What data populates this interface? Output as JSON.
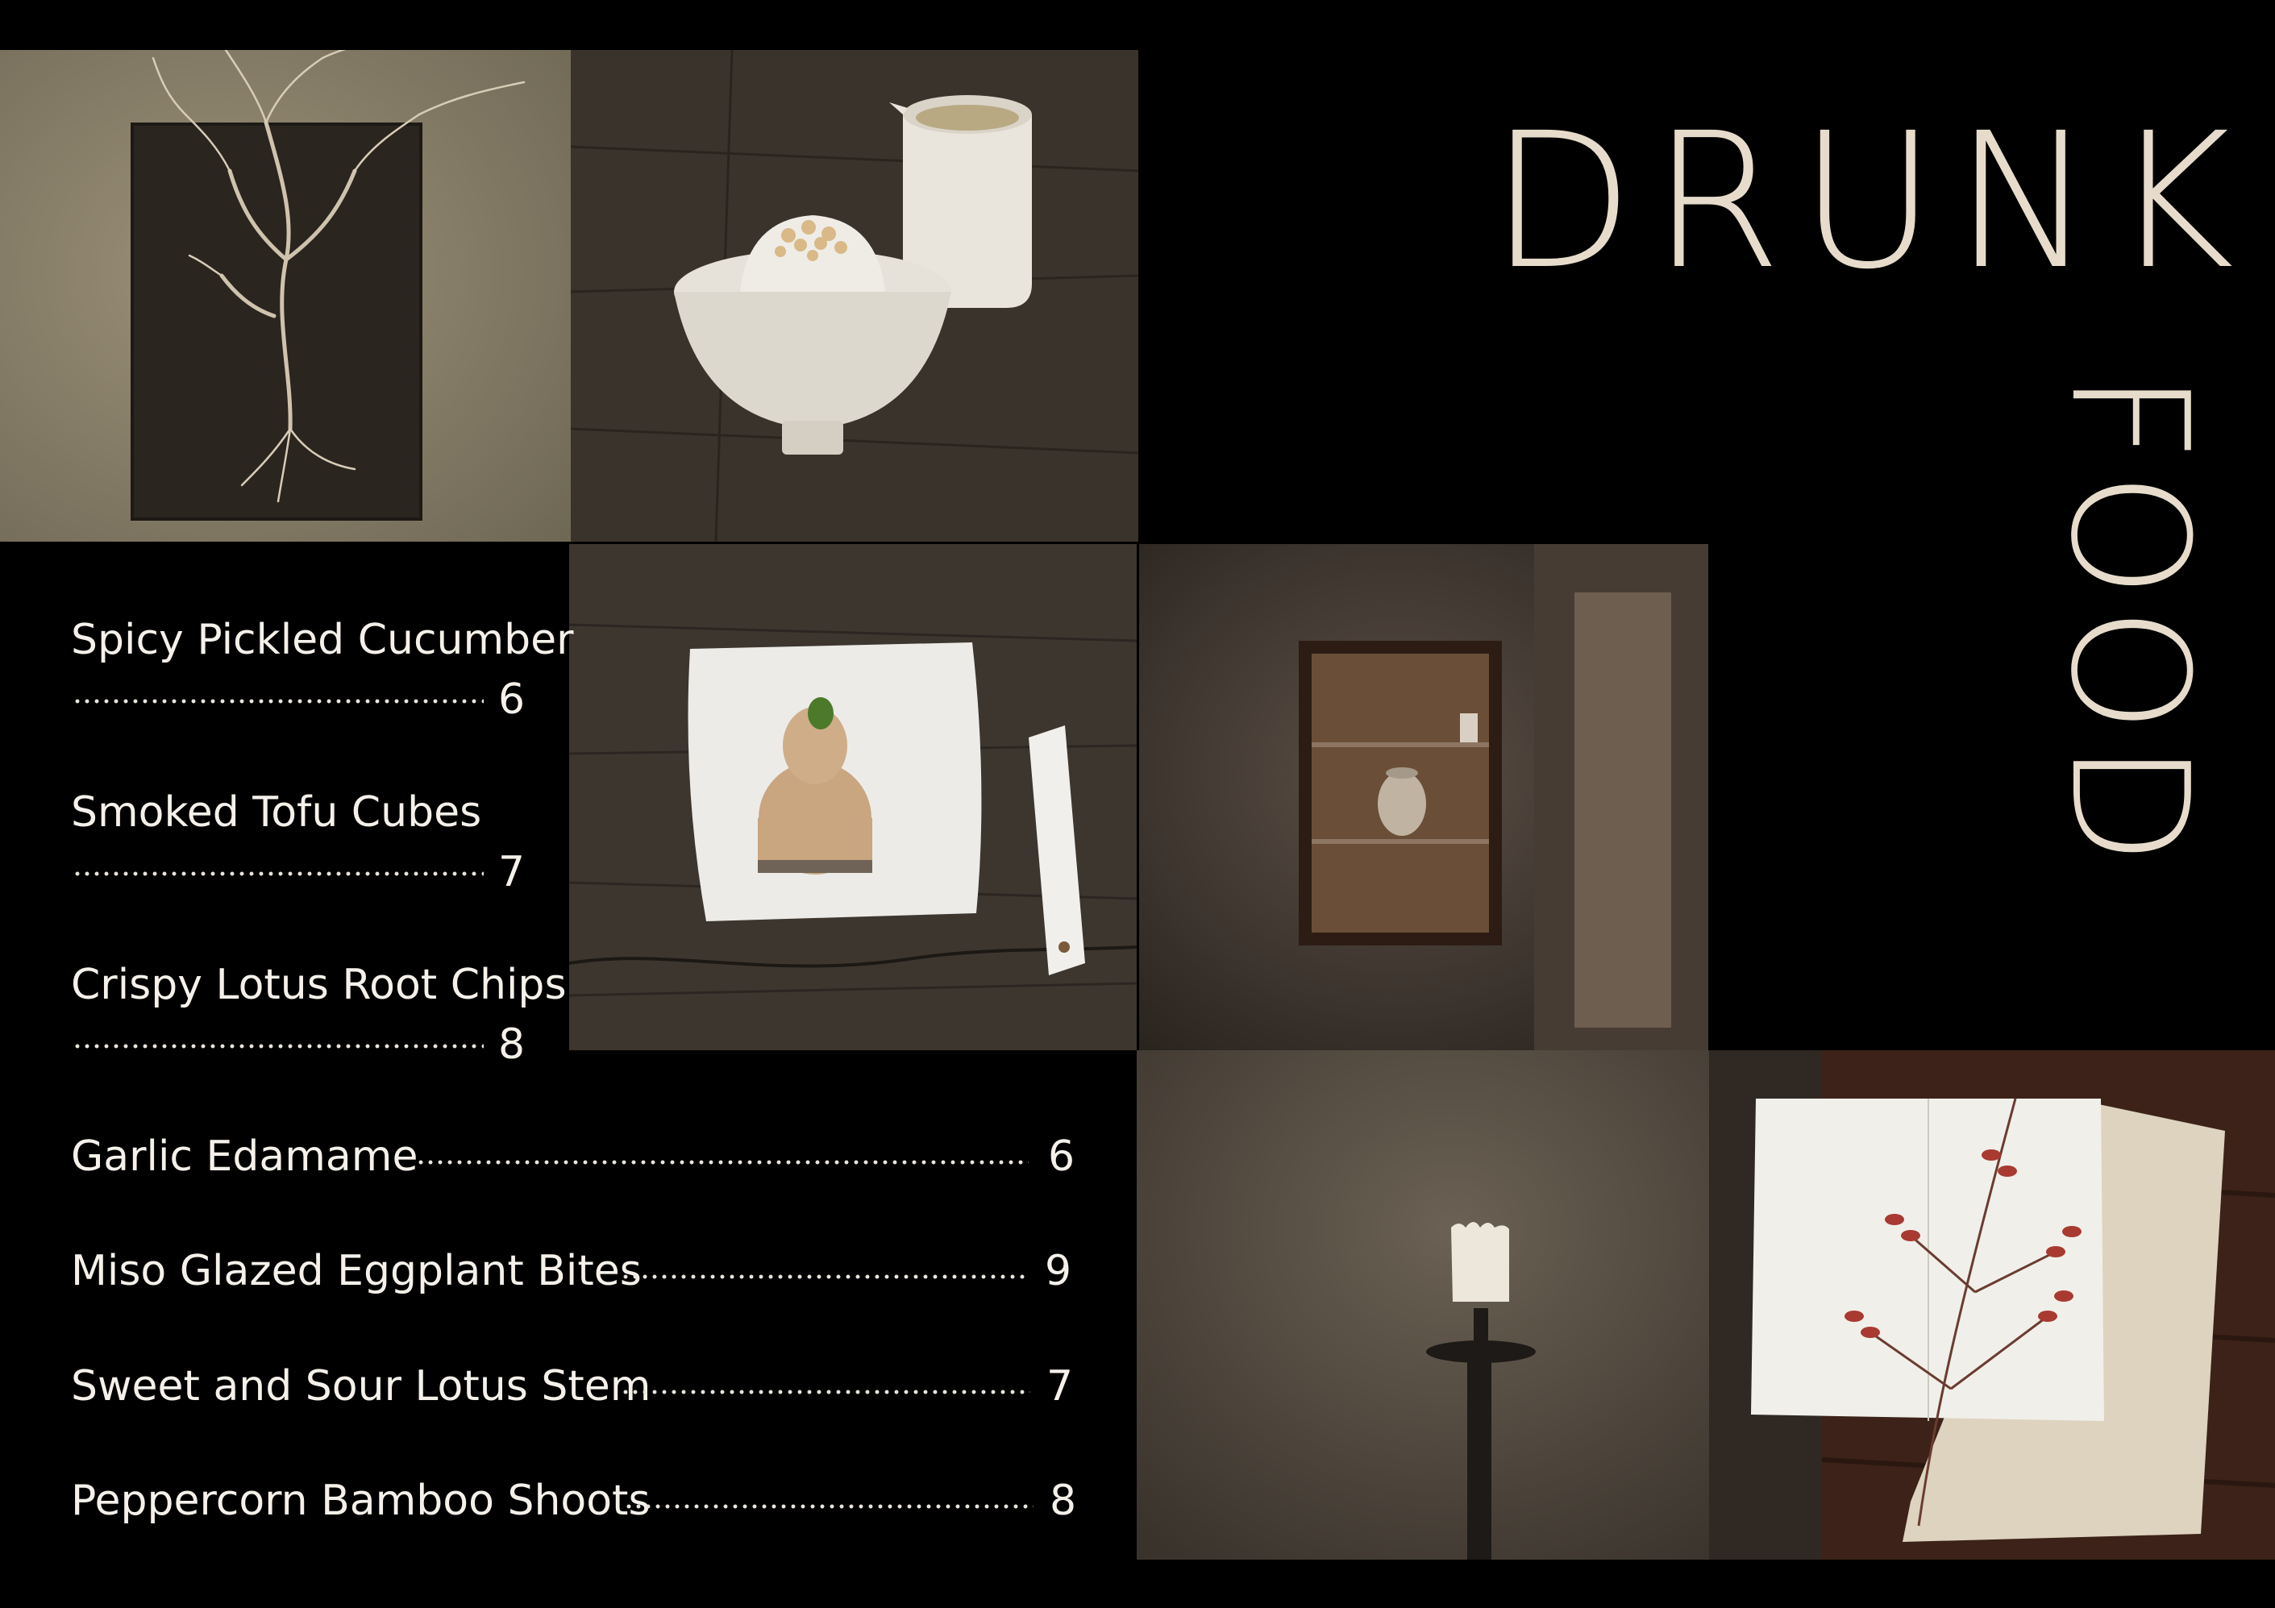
{
  "title": {
    "line1": "DRUNK",
    "line2": "FOOD"
  },
  "menu": {
    "items": [
      {
        "name": "Spicy Pickled Cucumber",
        "price": "6"
      },
      {
        "name": "Smoked Tofu Cubes",
        "price": "7"
      },
      {
        "name": "Crispy Lotus Root Chips",
        "price": "8"
      },
      {
        "name": "Garlic Edamame",
        "price": "6"
      },
      {
        "name": "Miso Glazed Eggplant Bites",
        "price": "9"
      },
      {
        "name": "Sweet and Sour Lotus Stem",
        "price": "7"
      },
      {
        "name": "Peppercorn Bamboo Shoots",
        "price": "8"
      }
    ]
  },
  "colors": {
    "background": "#000000",
    "title": "#e7dccb",
    "menu_text": "#f5f1ea"
  },
  "photos": [
    {
      "subject": "tree-branch-on-panel"
    },
    {
      "subject": "rice-bowl-and-pitcher"
    },
    {
      "subject": "dessert-plate-with-card"
    },
    {
      "subject": "wall-niche-with-jar"
    },
    {
      "subject": "candle-on-stand"
    },
    {
      "subject": "open-menu-booklet"
    }
  ]
}
